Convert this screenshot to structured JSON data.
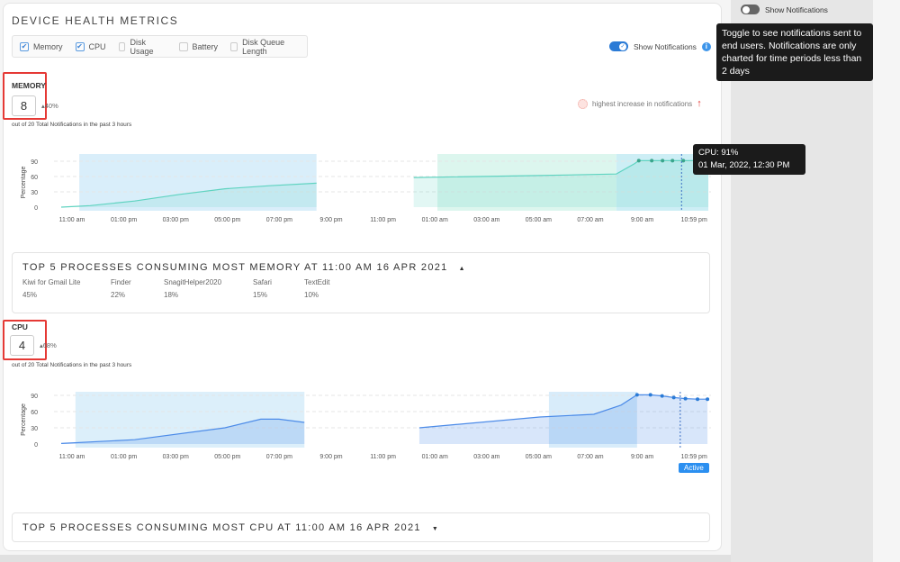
{
  "header": {
    "title": "DEVICE HEALTH METRICS"
  },
  "filters": [
    {
      "label": "Memory",
      "checked": true
    },
    {
      "label": "CPU",
      "checked": true
    },
    {
      "label": "Disk Usage",
      "checked": false
    },
    {
      "label": "Battery",
      "checked": false
    },
    {
      "label": "Disk Queue Length",
      "checked": false
    }
  ],
  "notifications": {
    "label": "Show Notifications",
    "enabled": true,
    "tooltip": "Toggle to see notifications sent to end users. Notifications are only charted for time periods less than 2 days",
    "highest_label": "highest increase in notifications"
  },
  "side_panel": {
    "toggle_label": "Show Notifications",
    "enabled": false
  },
  "colors": {
    "accent": "#2b7bd6",
    "memory": "#5fd3c0",
    "cpu": "#4c8be8",
    "band": "#d6ecf8",
    "highlight": "#e53935"
  },
  "memory": {
    "label": "MEMORY",
    "count": "8",
    "delta": "40%",
    "subtitle": "out of 20 Total Notifications in the past 3 hours",
    "hover_tooltip": {
      "line1": "CPU: 91%",
      "line2": "01 Mar, 2022, 12:30 PM"
    }
  },
  "cpu": {
    "label": "CPU",
    "count": "4",
    "delta": "68%",
    "subtitle": "out of 20 Total Notifications in the past 3 hours",
    "active_label": "Active"
  },
  "memory_processes": {
    "title": "TOP 5 PROCESSES CONSUMING MOST MEMORY AT 11:00 AM 16 APR 2021",
    "expanded": true,
    "items": [
      {
        "name": "Kiwi for Gmail Lite",
        "value": "45%"
      },
      {
        "name": "Finder",
        "value": "22%"
      },
      {
        "name": "SnagitHelper2020",
        "value": "18%"
      },
      {
        "name": "Safari",
        "value": "15%"
      },
      {
        "name": "TextEdit",
        "value": "10%"
      }
    ]
  },
  "cpu_processes": {
    "title": "TOP 5 PROCESSES CONSUMING MOST CPU AT 11:00 AM 16 APR 2021",
    "expanded": false
  },
  "chart_data": [
    {
      "type": "area",
      "ylabel": "Percentage",
      "ylim": [
        0,
        100
      ],
      "yticks": [
        0,
        30,
        60,
        90
      ],
      "xticks": [
        "11:00 am",
        "01:00 pm",
        "03:00 pm",
        "05:00 pm",
        "07:00 pm",
        "9:00 pm",
        "11:00 pm",
        "01:00 am",
        "03:00 am",
        "05:00 am",
        "07:00 am",
        "9:00 am",
        "10:59 pm"
      ],
      "segments": [
        [
          [
            "10:35 am",
            0
          ],
          [
            "11:42 am",
            3
          ],
          [
            "01:25 pm",
            12
          ],
          [
            "03:10 pm",
            25
          ],
          [
            "04:54 pm",
            36
          ],
          [
            "06:38 pm",
            42
          ],
          [
            "08:26 pm",
            47
          ]
        ],
        [
          [
            "12:11 am",
            58
          ],
          [
            "05:03 am",
            62
          ],
          [
            "08:00 am",
            65
          ],
          [
            "08:42 am",
            85
          ],
          [
            "08:52 am",
            91
          ],
          [
            "09:22 am",
            91
          ],
          [
            "09:47 am",
            91
          ],
          [
            "10:10 am",
            91
          ],
          [
            "10:35 am",
            91
          ],
          [
            "11:33 am",
            91
          ]
        ]
      ],
      "markers": [
        "08:52 am",
        "09:22 am",
        "09:47 am",
        "10:10 am",
        "10:35 am"
      ],
      "bands": [
        [
          "11:17 am",
          "08:26 pm",
          "#d9eefa"
        ],
        [
          "01:06 am",
          "08:00 am",
          "#dcf6ee"
        ],
        [
          "08:00 am",
          "11:33 am",
          "#cdeef5"
        ]
      ],
      "cursor": "10:31 am"
    },
    {
      "type": "area",
      "ylabel": "Percentage",
      "ylim": [
        0,
        100
      ],
      "yticks": [
        0,
        30,
        60,
        90
      ],
      "xticks": [
        "11:00 am",
        "01:00 pm",
        "03:00 pm",
        "05:00 pm",
        "07:00 pm",
        "9:00 pm",
        "11:00 pm",
        "01:00 am",
        "03:00 am",
        "05:00 am",
        "07:00 am",
        "9:00 am",
        "10:59 pm"
      ],
      "segments": [
        [
          [
            "10:35 am",
            1
          ],
          [
            "01:25 pm",
            8
          ],
          [
            "04:54 pm",
            30
          ],
          [
            "06:17 pm",
            46
          ],
          [
            "06:59 pm",
            46
          ],
          [
            "07:58 pm",
            40
          ]
        ],
        [
          [
            "12:24 am",
            30
          ],
          [
            "05:03 am",
            50
          ],
          [
            "07:08 am",
            55
          ],
          [
            "08:11 am",
            72
          ],
          [
            "08:48 am",
            91
          ],
          [
            "09:19 am",
            91
          ],
          [
            "09:46 am",
            89
          ],
          [
            "10:13 am",
            86
          ],
          [
            "10:40 am",
            84
          ],
          [
            "11:08 am",
            83
          ],
          [
            "11:31 am",
            83
          ]
        ]
      ],
      "markers": [
        "08:48 am",
        "09:19 am",
        "09:46 am",
        "10:13 am",
        "10:40 am",
        "11:08 am",
        "11:31 am"
      ],
      "bands": [
        [
          "11:08 am",
          "07:58 pm",
          "#dceffa"
        ],
        [
          "05:24 am",
          "08:48 am",
          "#d8ecfa"
        ]
      ],
      "cursor": "10:28 am"
    }
  ]
}
